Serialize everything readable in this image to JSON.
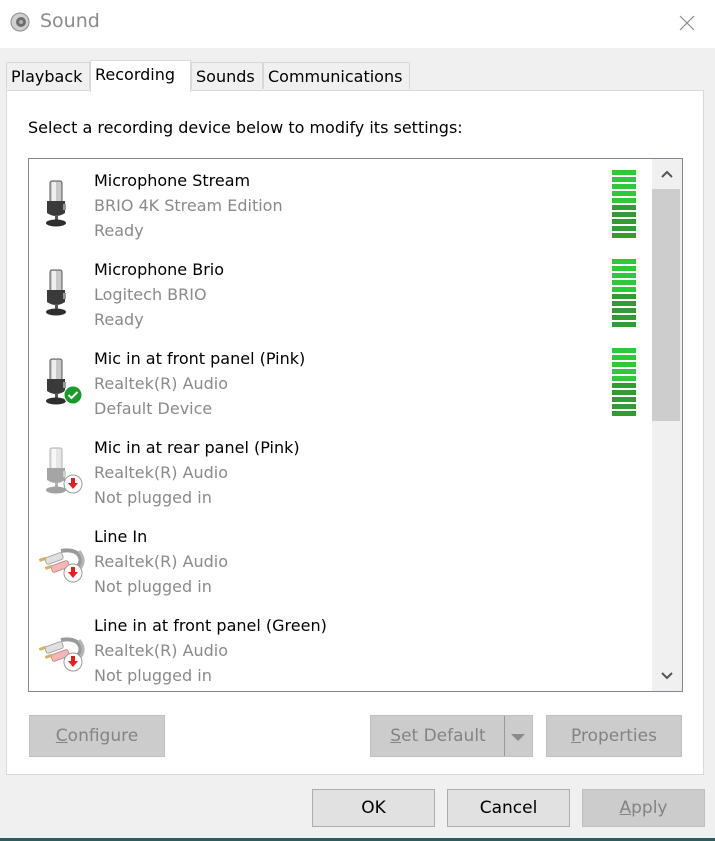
{
  "window": {
    "title": "Sound",
    "icon": "speaker-icon",
    "close_icon": "close-icon"
  },
  "tabs": [
    {
      "label": "Playback",
      "active": false
    },
    {
      "label": "Recording",
      "active": true
    },
    {
      "label": "Sounds",
      "active": false
    },
    {
      "label": "Communications",
      "active": false
    }
  ],
  "recording": {
    "instruction": "Select a recording device below to modify its settings:",
    "devices": [
      {
        "name": "Microphone Stream",
        "driver": "BRIO 4K Stream Edition",
        "status": "Ready",
        "icon": "microphone-icon",
        "badge": null,
        "meter_segments": 10
      },
      {
        "name": "Microphone Brio",
        "driver": "Logitech BRIO",
        "status": "Ready",
        "icon": "microphone-icon",
        "badge": null,
        "meter_segments": 10
      },
      {
        "name": "Mic in at front panel (Pink)",
        "driver": "Realtek(R) Audio",
        "status": "Default Device",
        "icon": "microphone-icon",
        "badge": "default-check-icon",
        "meter_segments": 10
      },
      {
        "name": "Mic in at rear panel (Pink)",
        "driver": "Realtek(R) Audio",
        "status": "Not plugged in",
        "icon": "microphone-icon",
        "badge": "unplugged-icon",
        "meter_segments": 0
      },
      {
        "name": "Line In",
        "driver": "Realtek(R) Audio",
        "status": "Not plugged in",
        "icon": "rca-cable-icon",
        "badge": "unplugged-icon",
        "meter_segments": 0
      },
      {
        "name": "Line in at front panel (Green)",
        "driver": "Realtek(R) Audio",
        "status": "Not plugged in",
        "icon": "rca-cable-icon",
        "badge": "unplugged-icon",
        "meter_segments": 0
      }
    ],
    "buttons": {
      "configure": {
        "label_ul": "C",
        "label_rest": "onfigure",
        "enabled": false
      },
      "set_default": {
        "label_ul": "S",
        "label_rest": "et Default",
        "enabled": false
      },
      "properties": {
        "label_ul": "P",
        "label_rest": "roperties",
        "enabled": false
      }
    }
  },
  "footer": {
    "ok": "OK",
    "cancel": "Cancel",
    "apply_ul": "A",
    "apply_rest": "pply"
  },
  "colors": {
    "meter_light": "#2ec83a",
    "meter_dark": "#349a34",
    "default_badge": "#1a9a2a",
    "unplugged_badge": "#e02020"
  }
}
